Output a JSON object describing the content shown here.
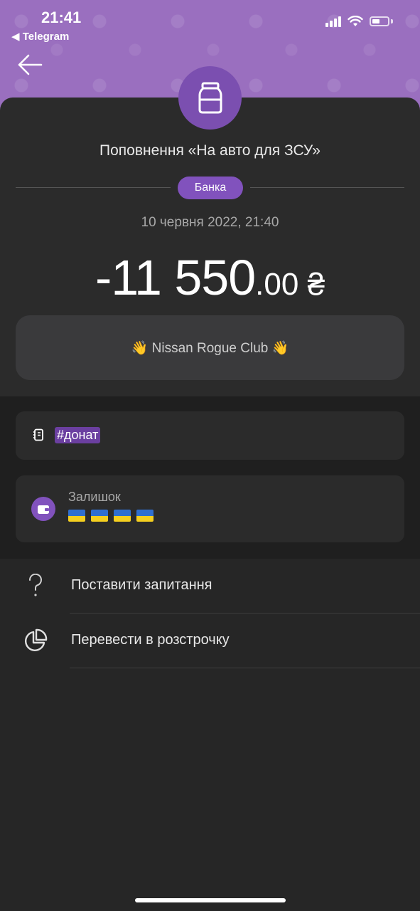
{
  "status": {
    "time": "21:41",
    "back_app": "◀ Telegram"
  },
  "transaction": {
    "title": "Поповнення «На авто для ЗСУ»",
    "category_badge": "Банка",
    "date": "10 червня 2022, 21:40",
    "amount_main": "-11 550",
    "amount_cents": ".00",
    "currency": "₴",
    "comment": "👋 Nissan Rogue Club 👋"
  },
  "tag": {
    "text": "#донат"
  },
  "balance": {
    "label": "Залишок",
    "flag_count": 4
  },
  "menu": {
    "items": [
      {
        "label": "Поставити запитання",
        "icon": "question-icon"
      },
      {
        "label": "Перевести в розстрочку",
        "icon": "pie-chart-icon"
      }
    ]
  },
  "colors": {
    "header_purple": "#9a6fbf",
    "accent_purple": "#8152bd",
    "card_bg": "#2b2b2b",
    "page_bg": "#262626"
  }
}
